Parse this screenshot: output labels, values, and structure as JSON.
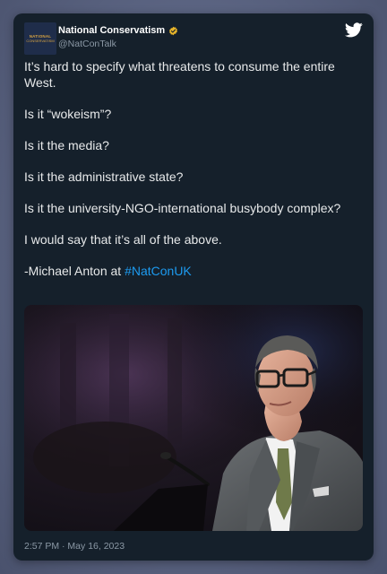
{
  "account": {
    "display_name": "National Conservatism",
    "handle": "@NatConTalk",
    "avatar_line1": "NATIONAL",
    "avatar_line2": "CONSERVATISM",
    "verified_color": "#e8b52a"
  },
  "tweet": {
    "paragraphs": [
      "It’s hard to specify what threatens to consume the entire West.",
      "Is it “wokeism”?",
      "Is it the media?",
      "Is it the administrative state?",
      "Is it the university-NGO-international busybody complex?",
      "I would say that it’s all of the above."
    ],
    "signature_prefix": "-Michael Anton at ",
    "hashtag": "#NatConUK",
    "timestamp": "2:57 PM · May 16, 2023"
  },
  "icons": {
    "brand": "twitter-bird-icon",
    "verified": "verified-badge-icon"
  },
  "colors": {
    "card_bg": "#15202b",
    "text": "#e7e9ea",
    "muted": "#8b98a5",
    "link": "#1d9bf0"
  }
}
